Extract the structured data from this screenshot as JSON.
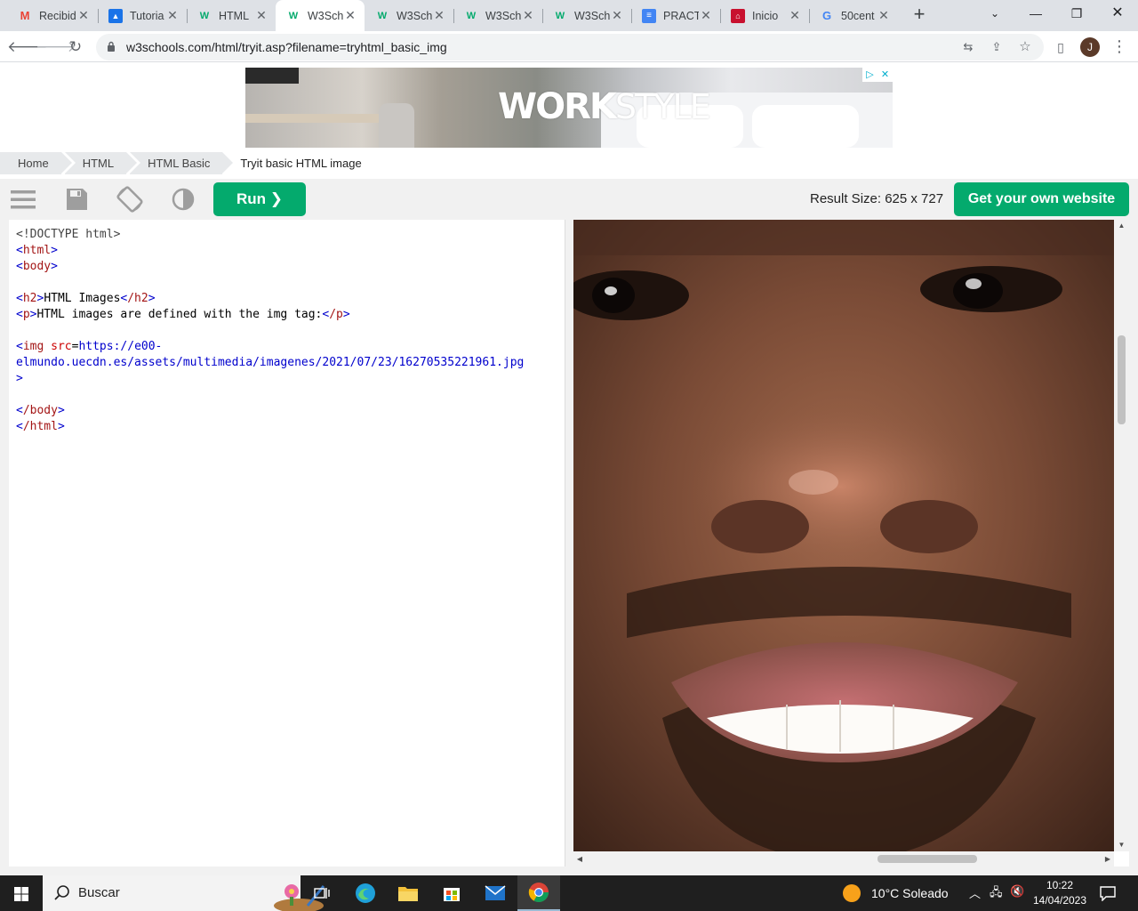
{
  "browser": {
    "tabs": [
      {
        "label": "Recibid",
        "icon": "gmail-icon",
        "active": false
      },
      {
        "label": "Tutoria",
        "icon": "classroom-icon",
        "active": false
      },
      {
        "label": "HTML",
        "icon": "w3schools-icon",
        "active": false
      },
      {
        "label": "W3Sch",
        "icon": "w3schools-icon",
        "active": true
      },
      {
        "label": "W3Sch",
        "icon": "w3schools-icon",
        "active": false
      },
      {
        "label": "W3Sch",
        "icon": "w3schools-icon",
        "active": false
      },
      {
        "label": "W3Sch",
        "icon": "w3schools-icon",
        "active": false
      },
      {
        "label": "PRACT",
        "icon": "google-docs-icon",
        "active": false
      },
      {
        "label": "Inicio",
        "icon": "school-portal-icon",
        "active": false
      },
      {
        "label": "50cent",
        "icon": "google-icon",
        "active": false
      }
    ],
    "url": "w3schools.com/html/tryit.asp?filename=tryhtml_basic_img",
    "profile_initial": "J"
  },
  "ad": {
    "brand": "WORK",
    "brand_suffix": "STYLE"
  },
  "breadcrumb": [
    "Home",
    "HTML",
    "HTML Basic",
    "Tryit basic HTML image"
  ],
  "toolbar": {
    "run_label": "Run ❯",
    "result_size": "Result Size: 625 x 727",
    "get_website_label": "Get your own website"
  },
  "code": {
    "l1": "<!DOCTYPE html>",
    "l2_open": "<",
    "l2_tag": "html",
    "l2_close": ">",
    "l3_tag": "body",
    "l5_tag": "h2",
    "l5_text": "HTML Images",
    "l5_end": "/h2",
    "l6_tag": "p",
    "l6_text": "HTML images are defined with the img tag:",
    "l6_end": "/p",
    "l8_tag": "img",
    "l8_attr": "src",
    "l8_eq": "=",
    "l8_val": "https://e00-",
    "l9_val": "elmundo.uecdn.es/assets/multimedia/imagenes/2021/07/23/16270535221961.jpg",
    "l10": ">",
    "l12_tag": "/body",
    "l13_tag": "/html"
  },
  "taskbar": {
    "search_label": "Buscar",
    "weather": "10°C  Soleado",
    "time": "10:22",
    "date": "14/04/2023"
  }
}
